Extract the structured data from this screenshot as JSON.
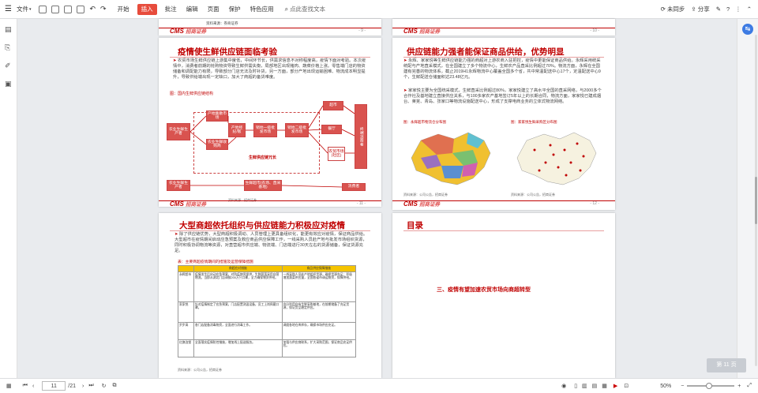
{
  "toolbar": {
    "file": "文件",
    "start": "开始",
    "insert": "插入",
    "review": "批注",
    "edit": "编辑",
    "page": "页面",
    "protect": "保护",
    "features": "特色应用",
    "search_placeholder": "点此查找文本",
    "sync": "未同步",
    "share": "分享"
  },
  "pages": {
    "p9": {
      "source": "资料来源：券商证券",
      "brand_a": "CMS",
      "brand_b": "招商证券",
      "num": "- 9 -"
    },
    "p10": {
      "brand_a": "CMS",
      "brand_b": "招商证券",
      "num": "- 10 -"
    },
    "p11": {
      "title": "疫情使生鲜供应链面临考验",
      "bullet": "农贸市场生鲜供应链上游集中度低，中间环节长，供需求信息不对称程度高，疫情下面对考验。本次疫情中，消费者前期的抢购物资导致生鲜供需失衡，局部地区出现猪肉、蔬菜价格上涨。零售端门店的物资储备和调配能力有限，导致部分门店无法及时补货，另一方面，部分产地出现运输困难、物流成本明显提升，导致供给端出现一定缺口，加大了商超的备货难度。",
      "figlabel": "图：国内生鲜供应链结构",
      "source": "资料来源：招商证券",
      "num": "- 11 -",
      "brand_a": "CMS",
      "brand_b": "招商证券",
      "nodes": {
        "farmer": "农业生鲜生产者",
        "base": "产地集散市场",
        "broker": "产地经纪/贩",
        "coop": "农业生鲜收购商",
        "wholesale1": "销地一级批发市场",
        "wholesale2": "销地二级批发市场",
        "supermarket": "超市",
        "restaurant": "餐厅",
        "market": "农贸市场(社区)",
        "consumer": "终端消费者",
        "chain": "生鲜供应链冗长",
        "farmer2": "农业生鲜生产者",
        "supply": "生鲜超市(农场、直采基地)",
        "consumer2": "消费者"
      }
    },
    "p12": {
      "title": "供应链能力强者能保证商品供给，优势明显",
      "b1": "永辉、家家悦等生鲜供应链能力强的商超对上游农商入驻把控，疫情中更能保证商品供给。永辉采用统采统配与产地直采模式，在全国建立了多个物流中心，生鲜农产品直采比例超过70%。物流方面，永辉在全国建有完善的物流体系，截止2019H1永辉物流中心覆盖全国多个省，共中常温配送中心17个，定温配送中心9个，生鲜配送仓储面积达23.48亿元。",
      "b2": "家家悦主要为全国统采模式，生鲜直采比例超过80%，家家悦建立了高水平全国的直采网络，与2000多个合作社及基地建立直接供应关系，与100多家农产基地签订5年以上的长期合同，物流方面，家家悦已建成烟台、莱芜、青岛、张家口等物流设施配送中心，形成了支撑电商业务的立体式物流网络。",
      "fig1": "图：永辉超市物流仓分布图",
      "fig2": "图：家家悦生鲜采购区分布图",
      "src1": "资料来源：公司公告，招商证券",
      "src2": "资料来源：公司公告，招商证券",
      "num": "- 12 -",
      "brand_a": "CMS",
      "brand_b": "招商证券"
    },
    "p13": {
      "title": "大型商超依托组织与供应链能力积极应对疫情",
      "bullet": "除了供应链优势，大型商超积极调动、人员管理上更具备组织化，能更有效应对疫情，保证商品供给。大型超市在疫情期间启动应急预案及救应商品供应保障工作，一线采购人员赴产地与批发市场组织货源，同时积极协调物流等资源，对直营超市供应端、物流端、门店端进行30天左右的货源储备，保证货源充足。",
      "figlabel": "表：主要商超疫情期间的措施及运营保障措施",
      "head1": "商超应对措施",
      "head2": "商品供应保障措施",
      "rows": [
        {
          "name": "永辉超市",
          "c1": "疫情发生后启动应急预案，对防疫物资保供，生鲜蔬菜采用自营物流。当即从湖北门店调拨200万只口罩，全力确保物资供给。",
          "c2": "一线采购人员赴产地组织货源，确保货源充足；积极增加蔬菜供应量，全国各省市调运物资，保障供给。"
        },
        {
          "name": "家家悦",
          "c1": "针对疫情制定了应急预案，门店配置测温设备，员工上岗佩戴口罩。",
          "c2": "充分利用自有生鲜采购基地，在前期储备了充足货源，保证货品稳定供应。"
        },
        {
          "name": "步步高",
          "c1": "各门店配备消毒物资，全面进行消毒工作。",
          "c2": "调度各地仓库库存，确保市场供应充足。"
        },
        {
          "name": "红旗连锁",
          "c1": "全面落实疫情防控措施，增加线上配送服务。",
          "c2": "加强与供应商联系，扩大采购范围，保证商品充足供应。"
        }
      ],
      "source": "资料来源：公司公告，招商证券",
      "num": "- 13 -",
      "brand_a": "CMS",
      "brand_b": "招商证券"
    },
    "p14": {
      "title": "目录",
      "item": "三、疫情有望加速农贸市场向商超转型"
    }
  },
  "page_badge": "第 11 页",
  "status": {
    "page_current": "11",
    "page_total": "/21",
    "zoom": "50%"
  }
}
